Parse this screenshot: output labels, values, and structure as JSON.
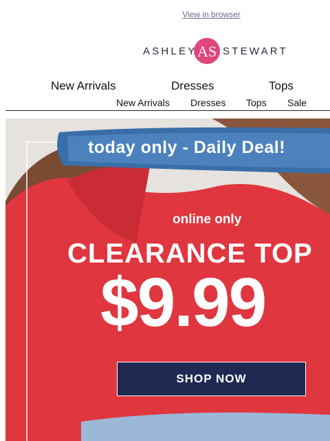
{
  "header": {
    "view_in_browser": "View in browser"
  },
  "brand": {
    "left": "ASHLEY",
    "right": "STEWART",
    "mark": "AS",
    "mark_color": "#e0457b"
  },
  "nav_primary": [
    "New Arrivals",
    "Dresses",
    "Tops"
  ],
  "nav_secondary": [
    "New Arrivals",
    "Dresses",
    "Tops",
    "Sale"
  ],
  "hero": {
    "deal": "today only - Daily Deal!",
    "online": "online only",
    "headline": "CLEARANCE TOP",
    "price": "$9.99",
    "cta": "SHOP NOW",
    "colors": {
      "top": "#e0363f",
      "banner": "#3a6ea8",
      "button": "#1e2a52"
    }
  }
}
